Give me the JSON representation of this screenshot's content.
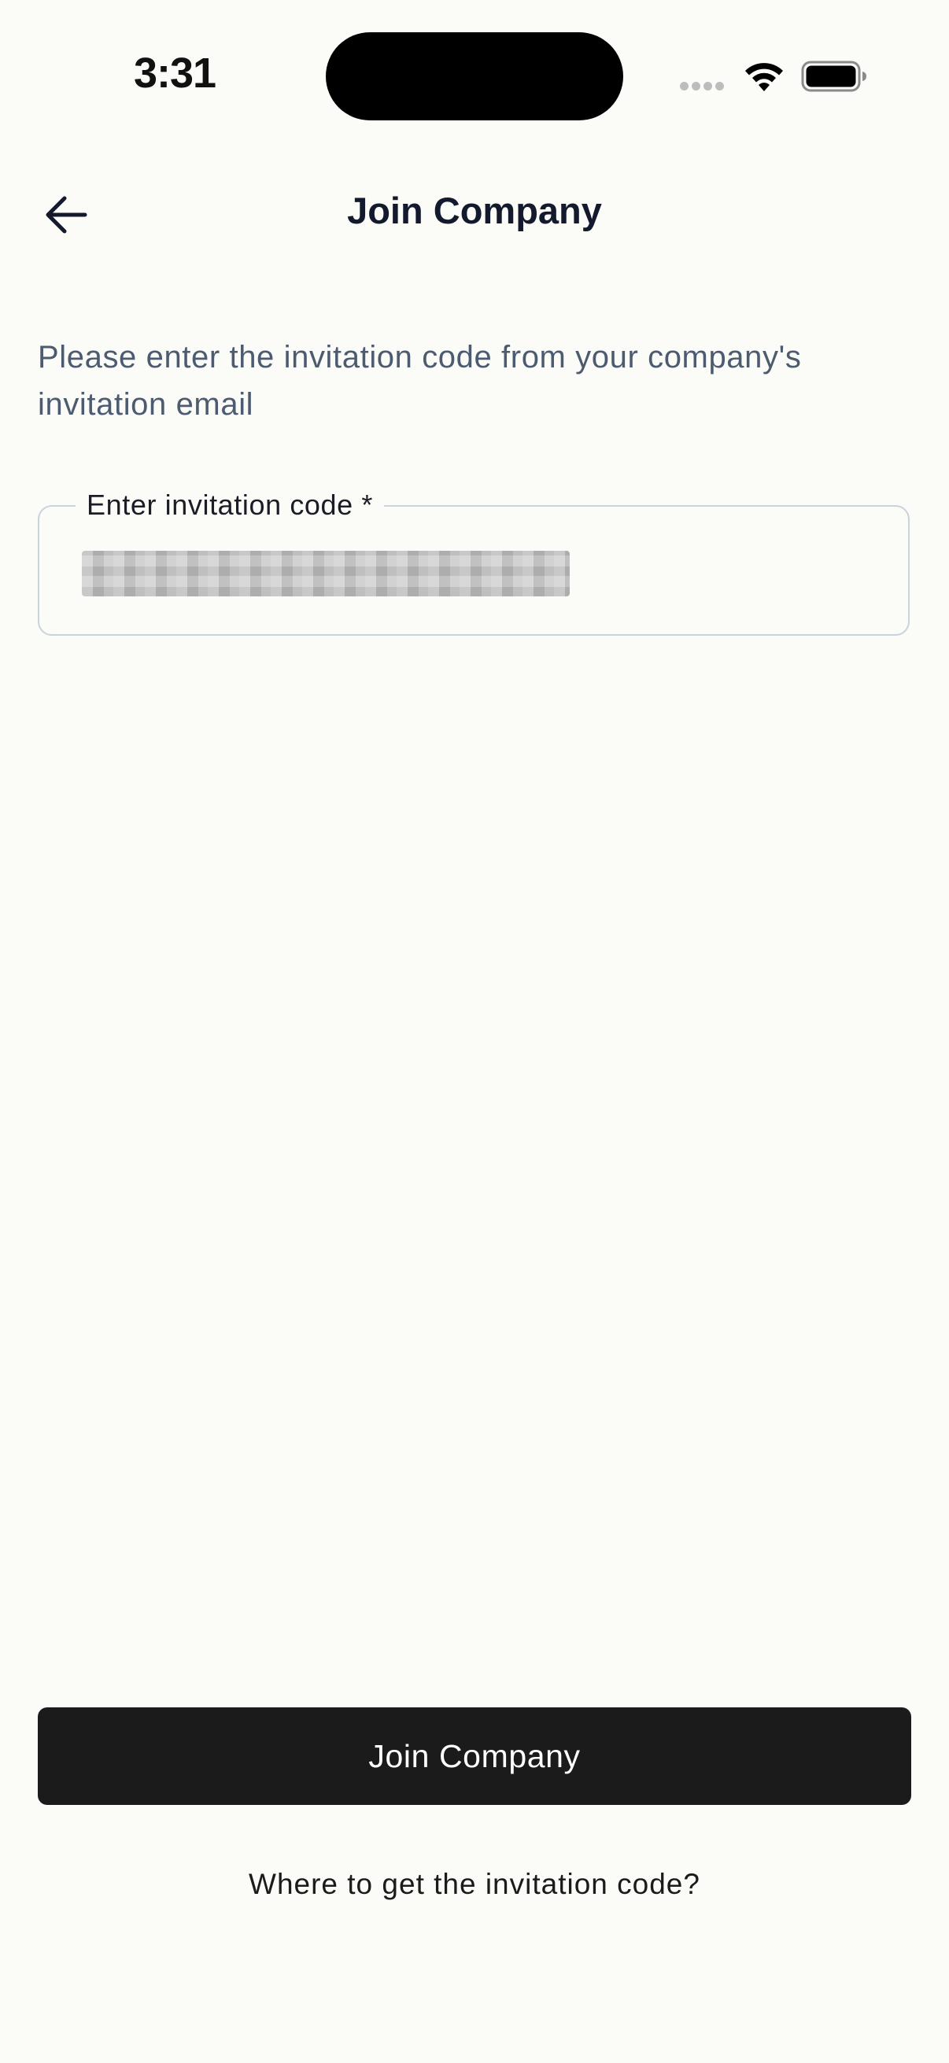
{
  "status_bar": {
    "time": "3:31"
  },
  "header": {
    "title": "Join Company",
    "back_icon": "arrow-left-icon"
  },
  "description": "Please enter the invitation code from your company's invitation email",
  "invitation_field": {
    "label": "Enter invitation code *",
    "value_redacted": true
  },
  "primary_button": {
    "label": "Join Company"
  },
  "help_link": {
    "label": "Where to get the invitation code?"
  },
  "colors": {
    "background": "#fbfbf8",
    "title_text": "#141a2e",
    "description_text": "#4c5b70",
    "field_border": "#c9d3de",
    "button_background": "#1b1b1b",
    "button_text": "#ffffff"
  }
}
